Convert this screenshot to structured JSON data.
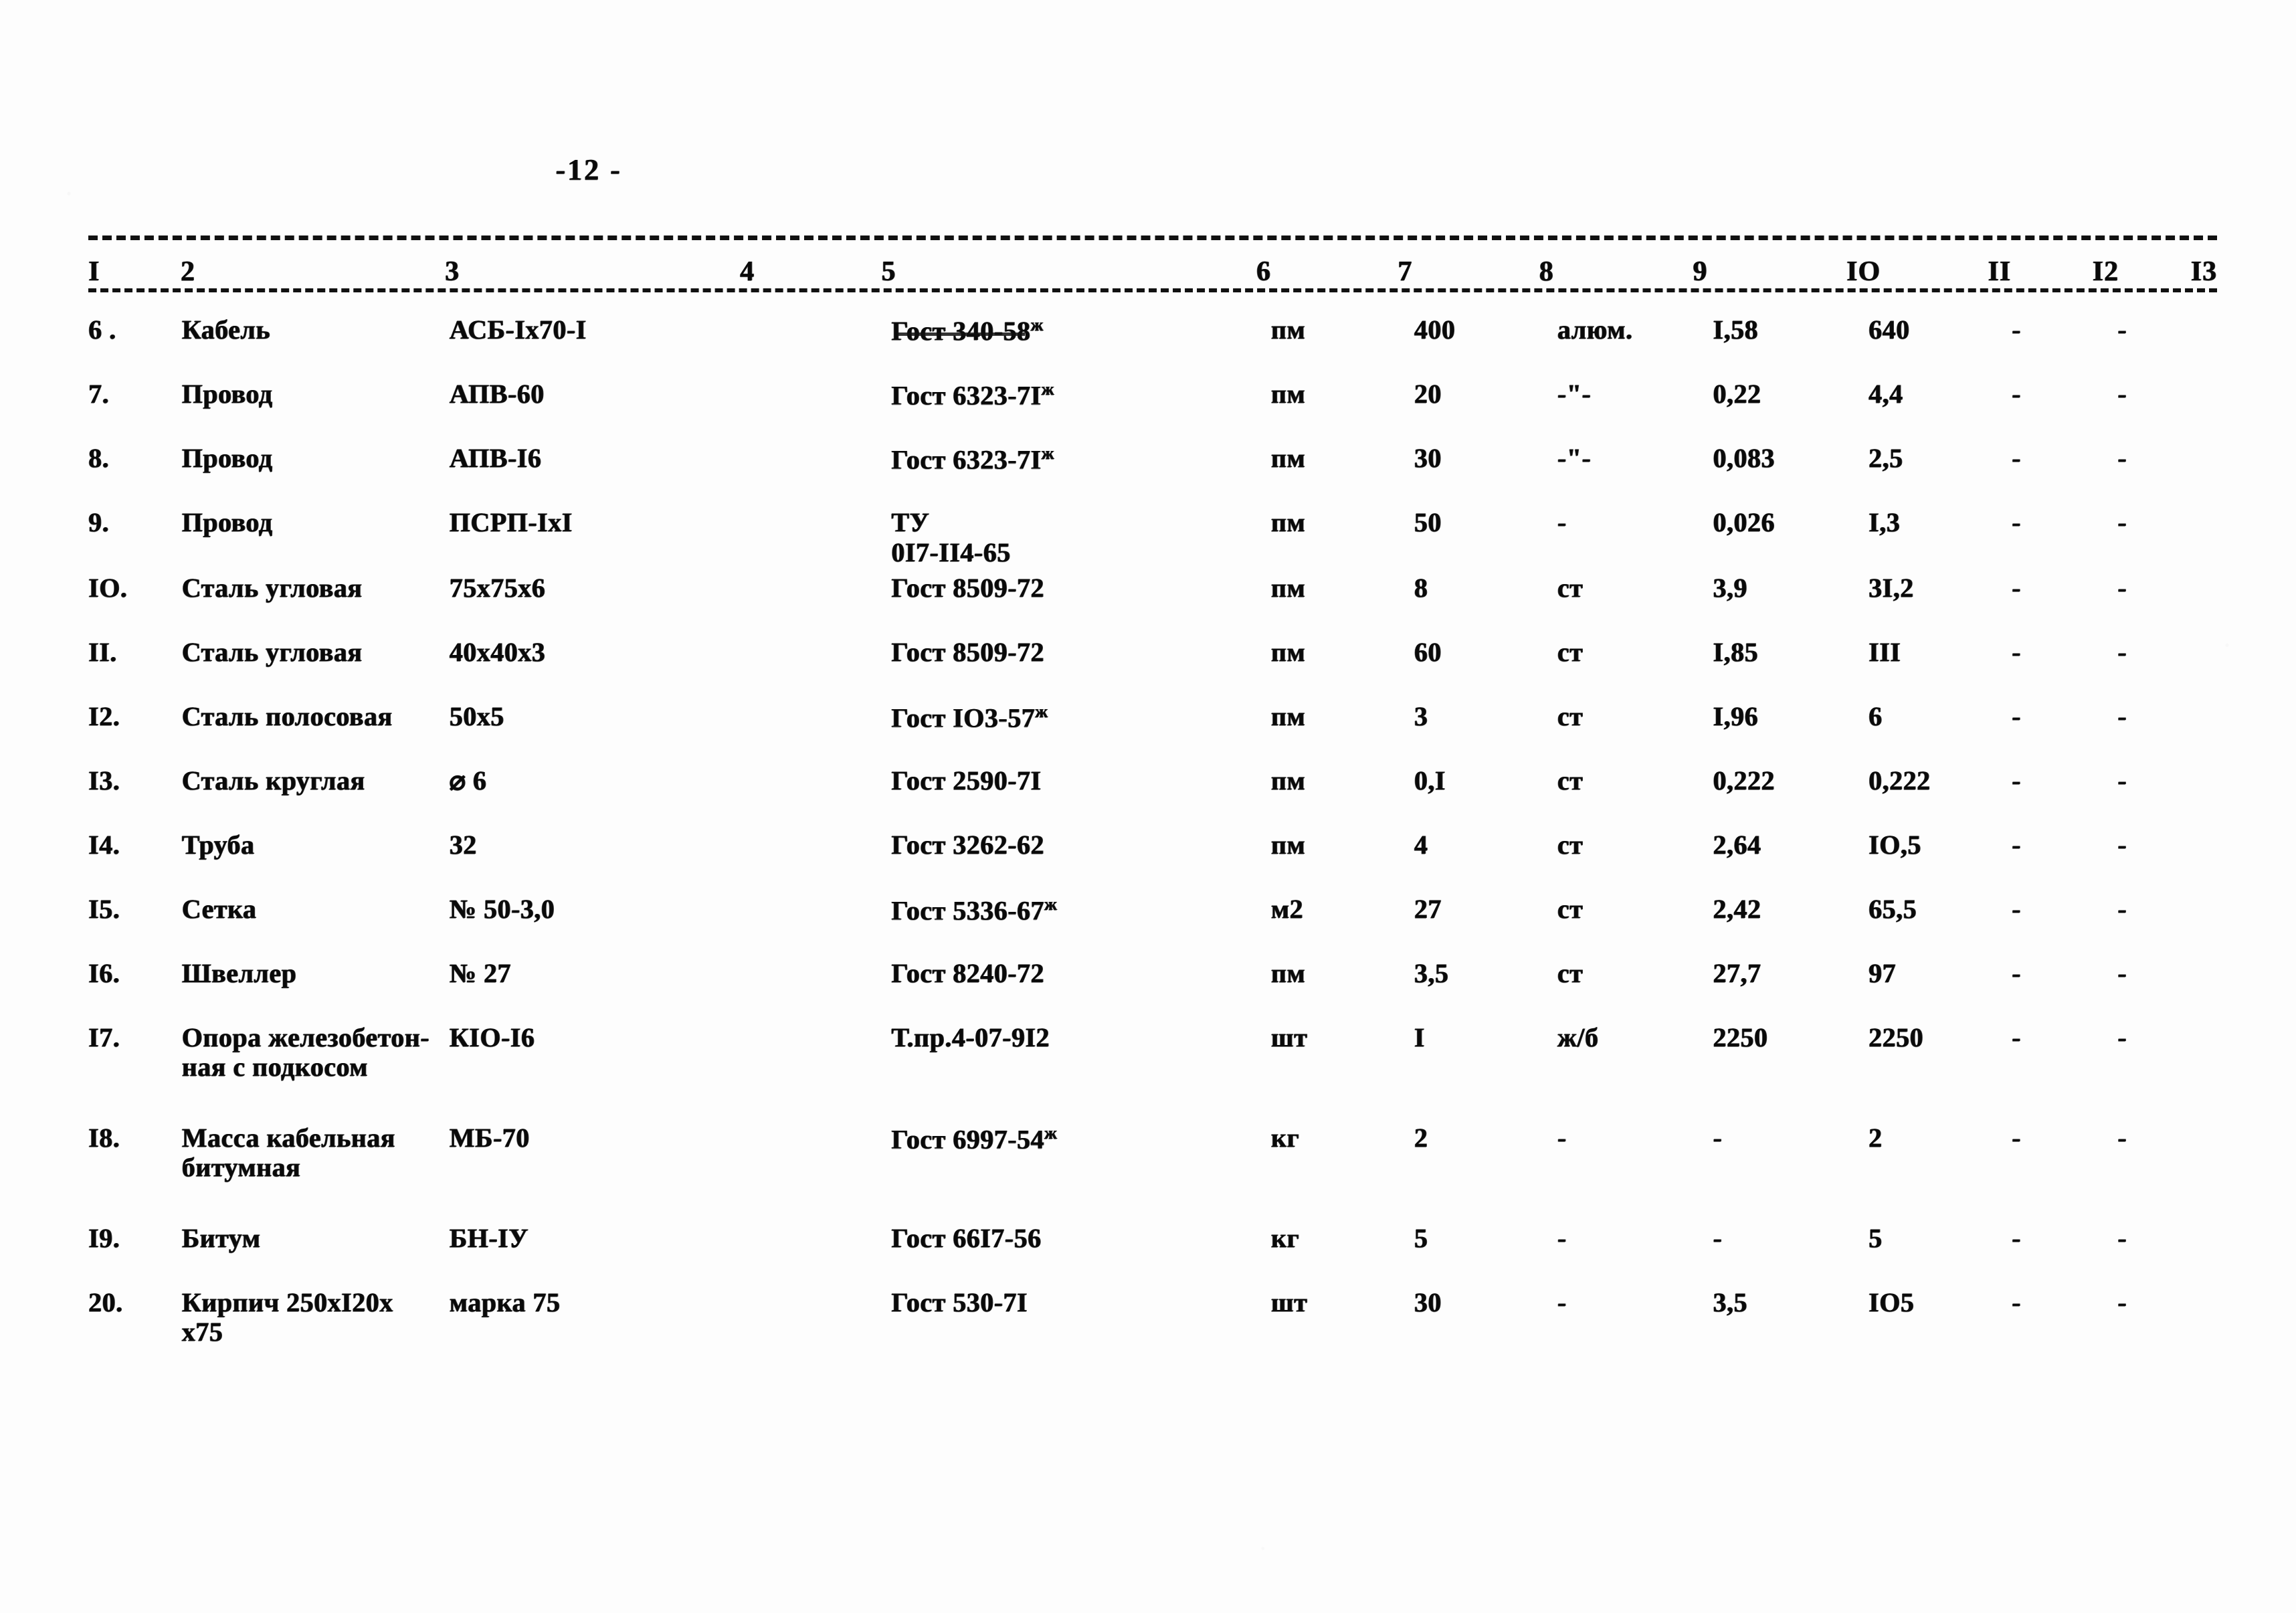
{
  "page": {
    "page_number_label": "-12 -"
  },
  "table": {
    "column_headers": [
      "I",
      "2",
      "3",
      "4",
      "5",
      "6",
      "7",
      "8",
      "9",
      "IO",
      "II",
      "I2",
      "I3"
    ],
    "rows": [
      {
        "num": "6 .",
        "name": "Кабель",
        "type": "АСБ-Iх70-I",
        "gost": "Гост 340-58",
        "gost_mark": "ж",
        "gost_overstruck": true,
        "unit": "пм",
        "qty": "400",
        "material": "алюм.",
        "w1": "I,58",
        "w2": "640",
        "d1": "-",
        "d2": "-"
      },
      {
        "num": "7.",
        "name": "Провод",
        "type": "АПВ-60",
        "gost": "Гост 6323-7I",
        "gost_mark": "ж",
        "gost_overstruck": false,
        "unit": "пм",
        "qty": "20",
        "material": "-\"-",
        "w1": "0,22",
        "w2": "4,4",
        "d1": "-",
        "d2": "-"
      },
      {
        "num": "8.",
        "name": "Провод",
        "type": "АПВ-I6",
        "gost": "Гост 6323-7I",
        "gost_mark": "ж",
        "gost_overstruck": false,
        "unit": "пм",
        "qty": "30",
        "material": "-\"-",
        "w1": "0,083",
        "w2": "2,5",
        "d1": "-",
        "d2": "-"
      },
      {
        "num": "9.",
        "name": "Провод",
        "type": "ПСРП-IхI",
        "gost": "ТУ\n0I7-II4-65",
        "gost_mark": "",
        "gost_overstruck": false,
        "unit": "пм",
        "qty": "50",
        "material": "-",
        "w1": "0,026",
        "w2": "I,3",
        "d1": "-",
        "d2": "-"
      },
      {
        "num": "IO.",
        "name": "Сталь угловая",
        "type": "75х75х6",
        "gost": "Гост 8509-72",
        "gost_mark": "",
        "gost_overstruck": false,
        "unit": "пм",
        "qty": "8",
        "material": "ст",
        "w1": "3,9",
        "w2": "3I,2",
        "d1": "-",
        "d2": "-"
      },
      {
        "num": "II.",
        "name": "Сталь угловая",
        "type": "40х40х3",
        "gost": "Гост 8509-72",
        "gost_mark": "",
        "gost_overstruck": false,
        "unit": "пм",
        "qty": "60",
        "material": "ст",
        "w1": "I,85",
        "w2": "III",
        "d1": "-",
        "d2": "-"
      },
      {
        "num": "I2.",
        "name": "Сталь полосовая",
        "type": "50х5",
        "gost": "Гост IO3-57",
        "gost_mark": "ж",
        "gost_overstruck": false,
        "unit": "пм",
        "qty": "3",
        "material": "ст",
        "w1": "I,96",
        "w2": "6",
        "d1": "-",
        "d2": "-"
      },
      {
        "num": "I3.",
        "name": "Сталь круглая",
        "type": "⌀ 6",
        "gost": "Гост 2590-7I",
        "gost_mark": "",
        "gost_overstruck": false,
        "unit": "пм",
        "qty": "0,I",
        "material": "ст",
        "w1": "0,222",
        "w2": "0,222",
        "d1": "-",
        "d2": "-"
      },
      {
        "num": "I4.",
        "name": "Труба",
        "type": "32",
        "gost": "Гост 3262-62",
        "gost_mark": "",
        "gost_overstruck": false,
        "unit": "пм",
        "qty": "4",
        "material": "ст",
        "w1": "2,64",
        "w2": "IO,5",
        "d1": "-",
        "d2": "-"
      },
      {
        "num": "I5.",
        "name": "Сетка",
        "type": "№ 50-3,0",
        "gost": "Гост 5336-67",
        "gost_mark": "ж",
        "gost_overstruck": false,
        "unit": "м2",
        "qty": "27",
        "material": "ст",
        "w1": "2,42",
        "w2": "65,5",
        "d1": "-",
        "d2": "-"
      },
      {
        "num": "I6.",
        "name": "Швеллер",
        "type": "№ 27",
        "gost": "Гост 8240-72",
        "gost_mark": "",
        "gost_overstruck": false,
        "unit": "пм",
        "qty": "3,5",
        "material": "ст",
        "w1": "27,7",
        "w2": "97",
        "d1": "-",
        "d2": "-"
      },
      {
        "num": "I7.",
        "name": "Опора железобетон-\nная с подкосом",
        "type": "КIО-I6",
        "gost": "Т.пр.4-07-9I2",
        "gost_mark": "",
        "gost_overstruck": false,
        "unit": "шт",
        "qty": "I",
        "material": "ж/б",
        "w1": "2250",
        "w2": "2250",
        "d1": "-",
        "d2": "-"
      },
      {
        "num": "I8.",
        "name": "Масса кабельная\nбитумная",
        "type": "МБ-70",
        "gost": "Гост 6997-54",
        "gost_mark": "ж",
        "gost_overstruck": false,
        "unit": "кг",
        "qty": "2",
        "material": "-",
        "w1": "-",
        "w2": "2",
        "d1": "-",
        "d2": "-"
      },
      {
        "num": "I9.",
        "name": "Битум",
        "type": "БН-IУ",
        "gost": "Гост 66I7-56",
        "gost_mark": "",
        "gost_overstruck": false,
        "unit": "кг",
        "qty": "5",
        "material": "-",
        "w1": "-",
        "w2": "5",
        "d1": "-",
        "d2": "-"
      },
      {
        "num": "20.",
        "name": "Кирпич 250хI20х\n      х75",
        "type": "марка 75",
        "gost": "Гост 530-7I",
        "gost_mark": "",
        "gost_overstruck": false,
        "unit": "шт",
        "qty": "30",
        "material": "-",
        "w1": "3,5",
        "w2": "IO5",
        "d1": "-",
        "d2": "-"
      }
    ]
  }
}
